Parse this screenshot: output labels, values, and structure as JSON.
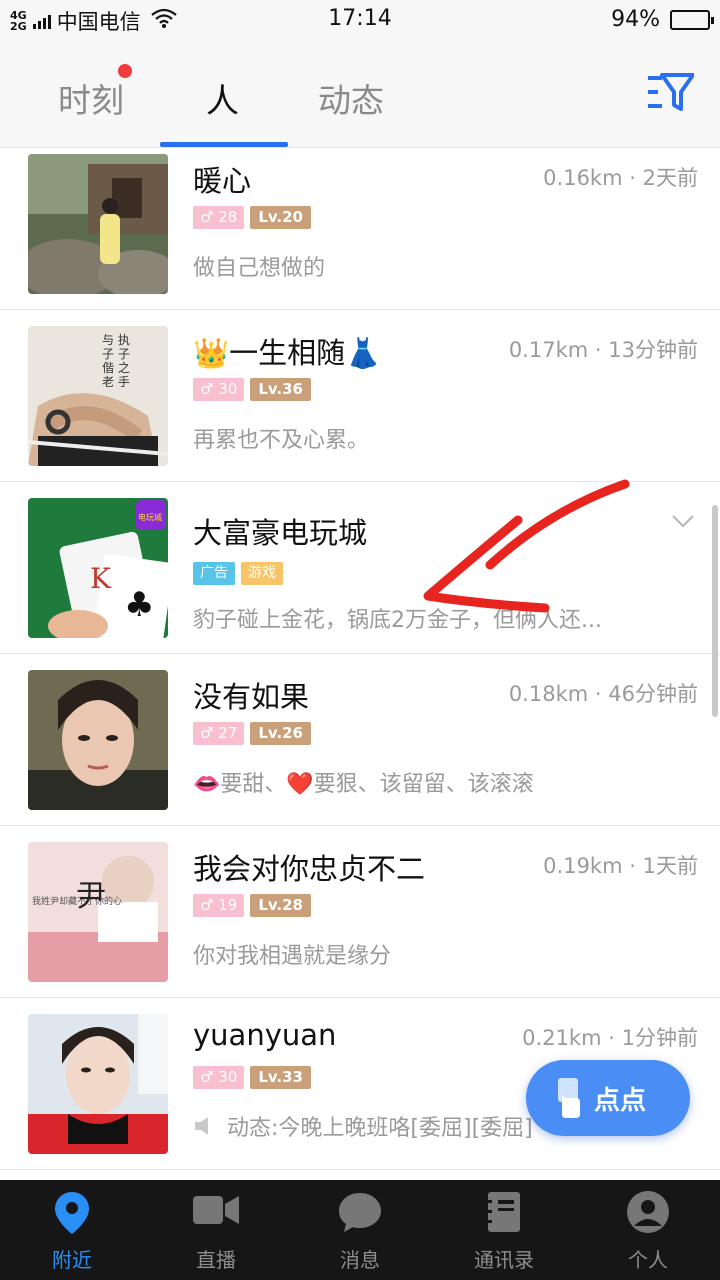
{
  "status_bar": {
    "network_top": "4G",
    "network_bottom": "2G",
    "carrier": "中国电信",
    "time": "17:14",
    "battery_text": "94%",
    "battery_level": 0.94
  },
  "tabs": {
    "moment": "时刻",
    "people": "人",
    "dynamic": "动态",
    "active": "people"
  },
  "colors": {
    "accent": "#2a6ff0",
    "nav_active": "#2a8ff5",
    "age_tag": "#f8bfd0",
    "level_tag": "#c9a07a",
    "ad_tag": "#58c4e8",
    "game_tag": "#f8c46a",
    "fab": "#4a8ef5",
    "annotation": "#e8241f"
  },
  "users": [
    {
      "name": "暖心",
      "distance": "0.16km",
      "time": "2天前",
      "age": "28",
      "level": "Lv.20",
      "signature": "做自己想做的"
    },
    {
      "name": "👑一生相随👗",
      "distance": "0.17km",
      "time": "13分钟前",
      "age": "30",
      "level": "Lv.36",
      "signature": "再累也不及心累。"
    },
    {
      "name": "大富豪电玩城",
      "ad_tag": "广告",
      "game_tag": "游戏",
      "signature": "豹子碰上金花，锅底2万金子，但俩人还..."
    },
    {
      "name": "没有如果",
      "distance": "0.18km",
      "time": "46分钟前",
      "age": "27",
      "level": "Lv.26",
      "signature": "👄要甜、❤️要狠、该留留、该滚滚"
    },
    {
      "name": "我会对你忠贞不二",
      "distance": "0.19km",
      "time": "1天前",
      "age": "19",
      "level": "Lv.28",
      "signature": "你对我相遇就是缘分"
    },
    {
      "name": "yuanyuan",
      "distance": "0.21km",
      "time": "1分钟前",
      "age": "30",
      "level": "Lv.33",
      "signature": "动态:今晚上晚班咯[委屈][委屈]"
    }
  ],
  "avatar_text": {
    "user2_line1": "与 执",
    "user2_line2": "子 子",
    "user2_line3": "偕 之",
    "user2_line4": "老 手",
    "user5_caption": "我姓尹却藏不了你的心",
    "user5_char": "尹",
    "ad_card_letter": "K",
    "ad_badge": "电玩城"
  },
  "separator": "·",
  "fab": {
    "label": "点点"
  },
  "bottom_nav": [
    {
      "label": "附近",
      "icon": "location-pin-icon"
    },
    {
      "label": "直播",
      "icon": "video-camera-icon"
    },
    {
      "label": "消息",
      "icon": "chat-bubble-icon"
    },
    {
      "label": "通讯录",
      "icon": "contacts-book-icon"
    },
    {
      "label": "个人",
      "icon": "person-icon"
    }
  ]
}
